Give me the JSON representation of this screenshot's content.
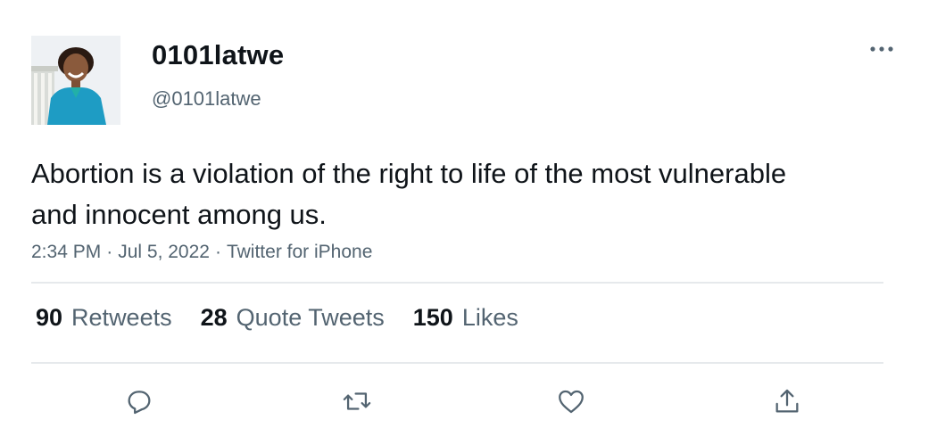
{
  "user": {
    "display_name": "0101latwe",
    "handle": "@0101latwe"
  },
  "tweet": {
    "text": "Abortion is a violation of the right to life of the most vulnerable and innocent among us.",
    "time": "2:34 PM",
    "date": "Jul 5, 2022",
    "source": "Twitter for iPhone",
    "separator": "·"
  },
  "stats": {
    "retweets_count": "90",
    "retweets_label": "Retweets",
    "quotes_count": "28",
    "quotes_label": "Quote Tweets",
    "likes_count": "150",
    "likes_label": "Likes"
  },
  "icons": {
    "more": "more-horizontal-icon",
    "reply": "reply-icon",
    "retweet": "retweet-icon",
    "like": "heart-icon",
    "share": "share-icon"
  },
  "colors": {
    "text": "#0f1419",
    "secondary": "#536471",
    "divider": "#e6e9ec"
  }
}
